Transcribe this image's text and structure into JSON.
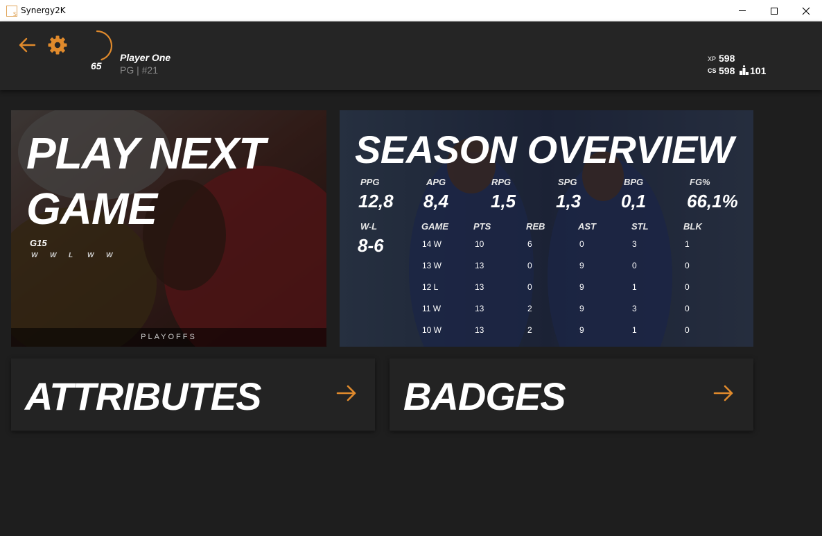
{
  "window": {
    "title": "Synergy2K",
    "app_icon_letter": "S",
    "controls": [
      "minimize-icon",
      "maximize-icon",
      "close-icon"
    ]
  },
  "header": {
    "back_icon": "arrow-left-icon",
    "settings_icon": "gear-icon",
    "overall": "65",
    "overall_progress": 0.65,
    "player_name": "Player One",
    "position_number": "PG | #21",
    "xp_label": "XP",
    "xp_value": "598",
    "cs_label": "CS",
    "cs_value": "598",
    "rank_icon": "podium-icon",
    "rank_value": "101"
  },
  "play_next": {
    "title_line1": "PLAY NEXT",
    "title_line2": "GAME",
    "game_label": "G15",
    "streak": [
      "W",
      "W",
      "L",
      "W",
      "W"
    ],
    "footer": "PLAYOFFS"
  },
  "season": {
    "title": "SEASON OVERVIEW",
    "stats": [
      {
        "label": "PPG",
        "value": "12,8"
      },
      {
        "label": "APG",
        "value": "8,4"
      },
      {
        "label": "RPG",
        "value": "1,5"
      },
      {
        "label": "SPG",
        "value": "1,3"
      },
      {
        "label": "BPG",
        "value": "0,1"
      },
      {
        "label": "FG%",
        "value": "66,1%"
      }
    ],
    "wl_label": "W-L",
    "wl_value": "8-6",
    "log_headers": [
      "GAME",
      "PTS",
      "REB",
      "AST",
      "STL",
      "BLK"
    ],
    "log_rows": [
      [
        "14 W",
        "10",
        "6",
        "0",
        "3",
        "1"
      ],
      [
        "13 W",
        "13",
        "0",
        "9",
        "0",
        "0"
      ],
      [
        "12 L",
        "13",
        "0",
        "9",
        "1",
        "0"
      ],
      [
        "11 W",
        "13",
        "2",
        "9",
        "3",
        "0"
      ],
      [
        "10 W",
        "13",
        "2",
        "9",
        "1",
        "0"
      ]
    ]
  },
  "nav": {
    "attributes": "ATTRIBUTES",
    "badges": "BADGES",
    "arrow_icon": "arrow-right-icon"
  },
  "colors": {
    "accent": "#e08a2c",
    "background": "#1e1e1e",
    "header": "#252525"
  }
}
